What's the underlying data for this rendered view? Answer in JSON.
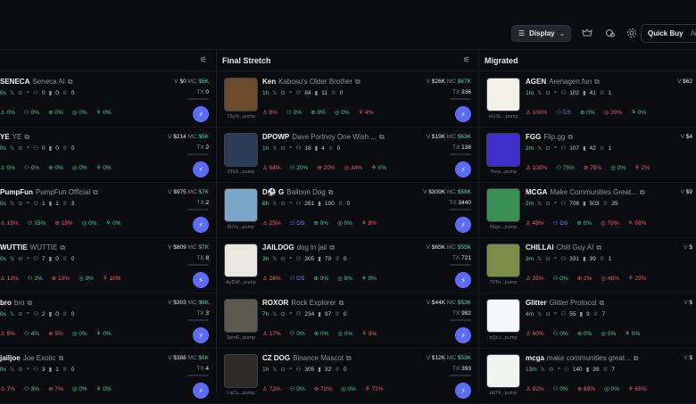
{
  "topbar": {
    "display_label": "Display",
    "quick_buy_label": "Quick Buy",
    "quick_buy_amount": "Am"
  },
  "columns": {
    "new_pairs": {
      "title": ""
    },
    "final_stretch": {
      "title": "Final Stretch"
    },
    "migrated": {
      "title": "Migrated"
    }
  },
  "left_rows": [
    {
      "ticker": "SENECA",
      "name": "Seneca AI",
      "age": "0s",
      "stats": [
        "0",
        "0",
        "0"
      ],
      "v": "$0",
      "mc": "$5K",
      "tx": "0",
      "pcts": [
        "0%",
        "0%",
        "0%",
        "0%",
        "0%"
      ]
    },
    {
      "ticker": "YE",
      "name": "YE",
      "age": "0s",
      "stats": [
        "0",
        "0",
        "0"
      ],
      "v": "$214",
      "mc": "$5K",
      "tx": "2",
      "pcts": [
        "0%",
        "0%",
        "0%",
        "0%",
        "0%"
      ]
    },
    {
      "ticker": "PumpFun",
      "name": "PumpFun Official",
      "age": "0s",
      "stats": [
        "1",
        "1",
        "3"
      ],
      "v": "$975",
      "mc": "$7K",
      "tx": "2",
      "pcts": [
        "15%",
        "15%",
        "15%",
        "0%",
        "0%"
      ]
    },
    {
      "ticker": "WUTTIE",
      "name": "WUTTIE",
      "age": "0s",
      "stats": [
        "7",
        "0",
        "0"
      ],
      "v": "$809",
      "mc": "$7K",
      "tx": "8",
      "pcts": [
        "13%",
        "3%",
        "13%",
        "0%",
        "10%"
      ]
    },
    {
      "ticker": "bro",
      "name": "bro",
      "age": "0s",
      "stats": [
        "2",
        "0",
        "0"
      ],
      "v": "$303",
      "mc": "$6K",
      "tx": "3",
      "pcts": [
        "5%",
        "4%",
        "5%",
        "0%",
        "0%"
      ]
    },
    {
      "ticker": "jailjoe",
      "name": "Joe Exotic",
      "age": "0s",
      "stats": [
        "3",
        "1",
        "0"
      ],
      "v": "$388",
      "mc": "$6K",
      "tx": "4",
      "pcts": [
        "7%",
        "3%",
        "7%",
        "0%",
        "0%"
      ]
    }
  ],
  "mid_rows": [
    {
      "ticker": "Ken",
      "name": "Kabosu's Older Brother",
      "age": "1h",
      "stats": [
        "84",
        "11",
        "0"
      ],
      "v": "$26K",
      "mc": "$67K",
      "tx": "336",
      "addr": "7SyS...pump",
      "pcts": [
        "8%",
        "0%",
        "0%",
        "0%",
        "4%"
      ]
    },
    {
      "ticker": "DPOWP",
      "name": "Dave Portnoy One Wish ...",
      "age": "1h",
      "stats": [
        "18",
        "4",
        "0"
      ],
      "v": "$19K",
      "mc": "$63K",
      "tx": "138",
      "addr": "9Tk3...pump",
      "pcts": [
        "64%",
        "20%",
        "20%",
        "34%",
        "0%"
      ]
    },
    {
      "ticker": "D⚽ G",
      "name": "Balloon Dog",
      "age": "6h",
      "stats": [
        "261",
        "100",
        "0"
      ],
      "v": "$309K",
      "mc": "$58K",
      "tx": "3440",
      "addr": "8uYy...pump",
      "pcts": [
        "25%",
        "DS",
        "0%",
        "0%",
        "8%"
      ]
    },
    {
      "ticker": "JAILDOG",
      "name": "dog in jail",
      "age": "3h",
      "stats": [
        "305",
        "79",
        "0"
      ],
      "v": "$65K",
      "mc": "$55K",
      "tx": "721",
      "addr": "AyDW...pump",
      "pcts": [
        "26%",
        "DS",
        "0%",
        "0%",
        "0%"
      ]
    },
    {
      "ticker": "ROXOR",
      "name": "Rock Explorer",
      "age": "7h",
      "stats": [
        "234",
        "97",
        "0"
      ],
      "v": "$44K",
      "mc": "$53K",
      "tx": "982",
      "addr": "9pmF...pump",
      "pcts": [
        "17%",
        "0%",
        "0%",
        "0%",
        "3%"
      ]
    },
    {
      "ticker": "CZ DOG",
      "name": "Binance Mascot",
      "age": "1h",
      "stats": [
        "305",
        "32",
        "0"
      ],
      "v": "$12K",
      "mc": "$53K",
      "tx": "393",
      "addr": "LqCs...pump",
      "pcts": [
        "72%",
        "0%",
        "72%",
        "0%",
        "72%"
      ]
    }
  ],
  "right_rows": [
    {
      "ticker": "AGEN",
      "name": "Arenagen.fun",
      "age": "1m",
      "stats": [
        "102",
        "41",
        "1"
      ],
      "v": "$62",
      "tx": "",
      "addr": "HUSL...pump",
      "pcts": [
        "100%",
        "DS",
        "0%",
        "20%",
        "0%"
      ]
    },
    {
      "ticker": "FGG",
      "name": "Flip.gg",
      "age": "2m",
      "stats": [
        "107",
        "42",
        "1"
      ],
      "v": "$4",
      "tx": "",
      "addr": "7kea...pump",
      "pcts": [
        "100%",
        "75%",
        "75%",
        "0%",
        "2%"
      ]
    },
    {
      "ticker": "MCGA",
      "name": "Make Communities Great...",
      "age": "2m",
      "stats": [
        "708",
        "503",
        "35"
      ],
      "v": "$9",
      "tx": "",
      "addr": "6bgn...pump",
      "pcts": [
        "48%",
        "DS",
        "0%",
        "79%",
        "98%"
      ]
    },
    {
      "ticker": "CHILLAI",
      "name": "Chill Guy AI",
      "age": "3m",
      "stats": [
        "331",
        "39",
        "1"
      ],
      "v": "$",
      "tx": "",
      "addr": "76Tn...pump",
      "pcts": [
        "35%",
        "0%",
        "2%",
        "48%",
        "29%"
      ]
    },
    {
      "ticker": "Glitter",
      "name": "Glitter Protocol",
      "age": "4m",
      "stats": [
        "55",
        "9",
        "7"
      ],
      "v": "$",
      "tx": "",
      "addr": "bQLv...pump",
      "pcts": [
        "60%",
        "0%",
        "0%",
        "0%",
        "0%"
      ]
    },
    {
      "ticker": "mcga",
      "name": "make communities great...",
      "age": "13m",
      "stats": [
        "140",
        "39",
        "7"
      ],
      "v": "$",
      "tx": "",
      "addr": "dd74...pump",
      "pcts": [
        "92%",
        "0%",
        "85%",
        "0%",
        "66%"
      ]
    }
  ],
  "colors": {
    "accent": "#5b6cf9",
    "green": "#3fcf8e",
    "red": "#ef5a6f",
    "blue": "#6b7cf6"
  },
  "icon_names": [
    "display-list-icon",
    "chevron-down-icon",
    "crown-icon",
    "wallet-icon",
    "settings-gear-icon",
    "filter-sliders-icon",
    "lightning-icon"
  ]
}
